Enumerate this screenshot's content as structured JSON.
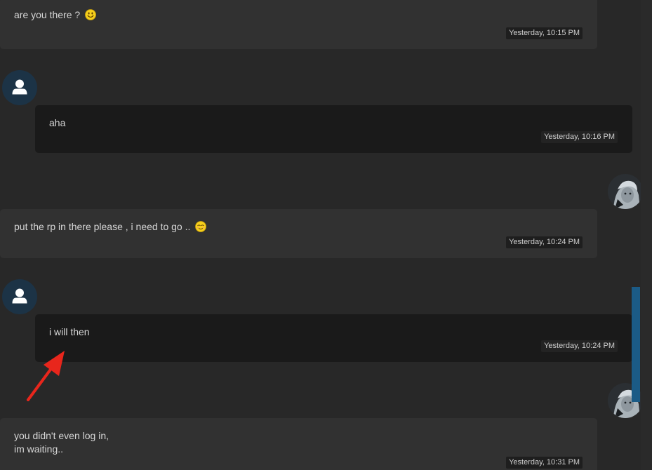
{
  "messages": [
    {
      "direction": "incoming",
      "text": "are you there ?",
      "emoji": "smile-emoji",
      "time": "Yesterday, 10:15 PM"
    },
    {
      "direction": "outgoing",
      "text": "aha",
      "time": "Yesterday, 10:16 PM"
    },
    {
      "direction": "incoming",
      "text": "put the rp in there please , i need to go ..",
      "emoji": "relieved-emoji",
      "time": "Yesterday, 10:24 PM"
    },
    {
      "direction": "outgoing",
      "text": "i will then",
      "time": "Yesterday, 10:24 PM"
    },
    {
      "direction": "incoming",
      "text": "you didn't even log in,\nim waiting..",
      "time": "Yesterday, 10:31 PM"
    }
  ],
  "icons": {
    "default_avatar": "user-icon",
    "annotation": "red-arrow"
  },
  "colors": {
    "background": "#282828",
    "incoming_bubble": "#313131",
    "outgoing_bubble": "#1a1a1a",
    "avatar_default": "#1c3346",
    "scrollbar_thumb": "#1b5b86",
    "annotation_arrow": "#e8261c",
    "emoji": "#f5cf1c"
  }
}
